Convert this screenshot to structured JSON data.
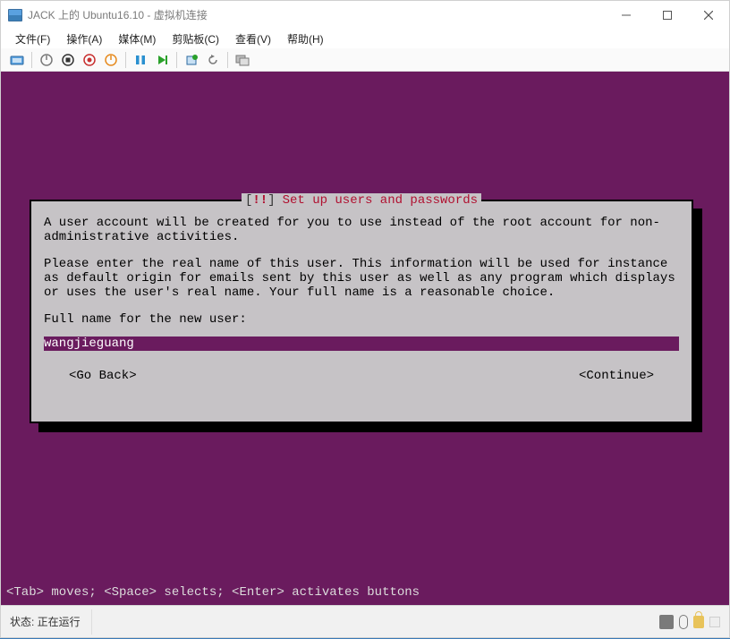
{
  "window": {
    "title": "JACK 上的 Ubuntu16.10 - 虚拟机连接"
  },
  "menu": {
    "file": "文件(F)",
    "action": "操作(A)",
    "media": "媒体(M)",
    "clipboard": "剪贴板(C)",
    "view": "查看(V)",
    "help": "帮助(H)"
  },
  "installer": {
    "title_bracket_open": "[",
    "title_bang": "!!",
    "title_bracket_close": "]",
    "title_text": "Set up users and passwords",
    "paragraph1": "A user account will be created for you to use instead of the root account for non-administrative activities.",
    "paragraph2": "Please enter the real name of this user. This information will be used for instance as default origin for emails sent by this user as well as any program which displays or uses the user's real name. Your full name is a reasonable choice.",
    "prompt": "Full name for the new user:",
    "input_value": "wangjieguang",
    "go_back": "<Go Back>",
    "continue": "<Continue>"
  },
  "helpbar": "<Tab> moves; <Space> selects; <Enter> activates buttons",
  "status": {
    "label": "状态: 正在运行"
  },
  "colors": {
    "vm_bg": "#6a1b5e",
    "dialog_bg": "#c6c3c6",
    "title_red": "#b01030"
  }
}
